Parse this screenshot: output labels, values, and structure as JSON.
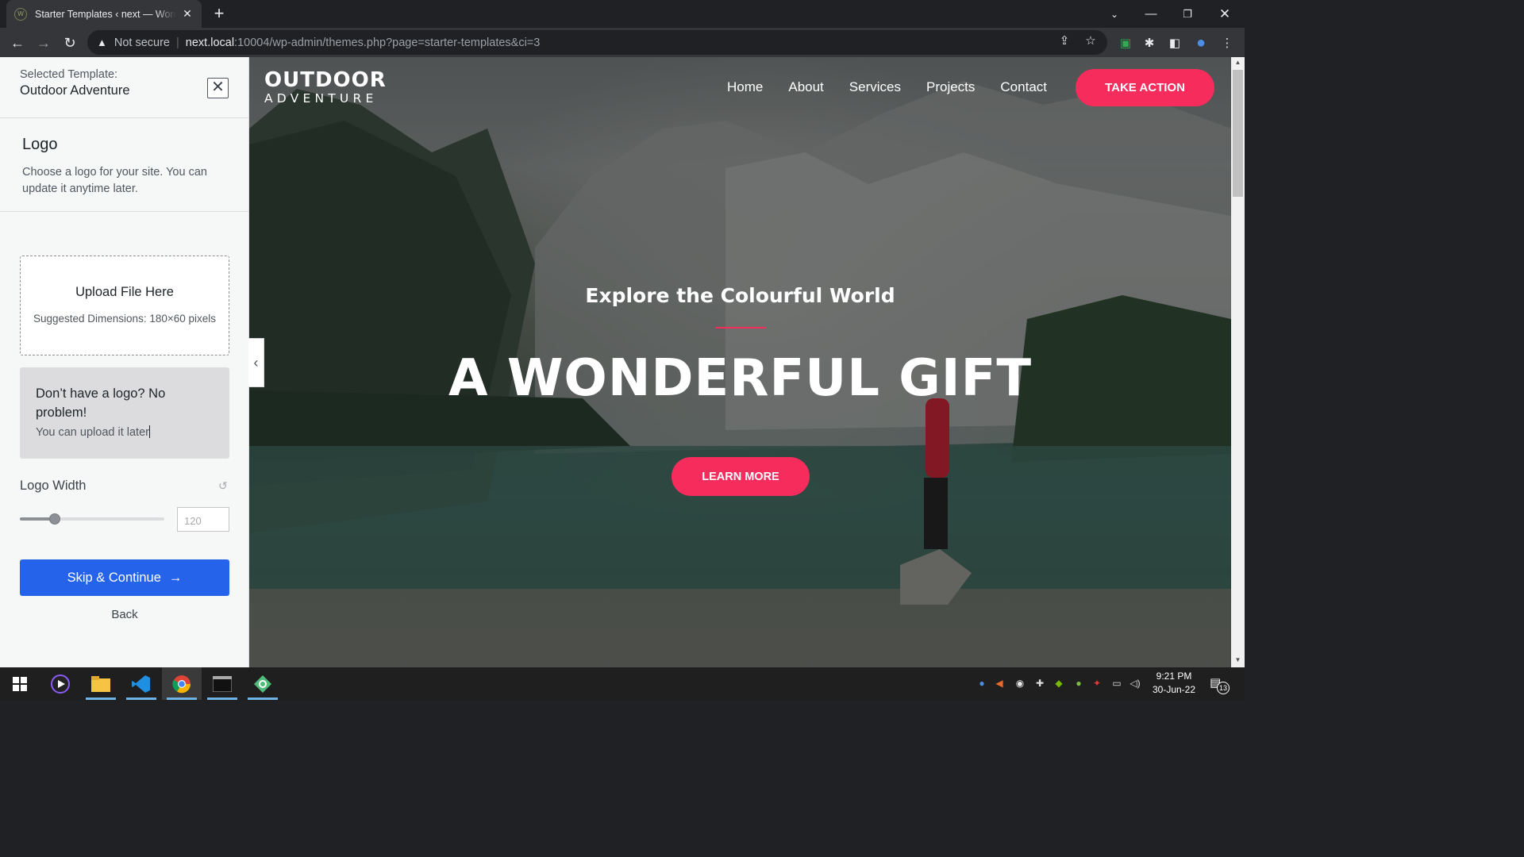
{
  "browser": {
    "tab_title": "Starter Templates ‹ next — WordPress",
    "favicon_text": "W",
    "url_warning": "Not secure",
    "url_host": "next.local",
    "url_path": ":10004/wp-admin/themes.php?page=starter-templates&ci=3"
  },
  "sidebar": {
    "selected_label": "Selected Template:",
    "selected_name": "Outdoor Adventure",
    "step_title": "Logo",
    "step_desc": "Choose a logo for your site. You can update it anytime later.",
    "upload_title": "Upload File Here",
    "upload_dims": "Suggested Dimensions: 180×60 pixels",
    "nologo_title": "Don’t have a logo? No problem!",
    "nologo_sub": "You can upload it later",
    "logo_width_label": "Logo Width",
    "logo_width_value": "120",
    "logo_width_fraction": 0.24,
    "skip_label": "Skip & Continue",
    "back_label": "Back"
  },
  "preview": {
    "logo_line1": "OUTDOOR",
    "logo_line2": "ADVENTURE",
    "nav": [
      "Home",
      "About",
      "Services",
      "Projects",
      "Contact"
    ],
    "cta": "TAKE ACTION",
    "kicker": "Explore the Colourful World",
    "headline": "A WONDERFUL GIFT",
    "button": "LEARN MORE",
    "accent": "#f52c5c"
  },
  "taskbar": {
    "time": "9:21 PM",
    "date": "30-Jun-22",
    "notifications": "13"
  }
}
